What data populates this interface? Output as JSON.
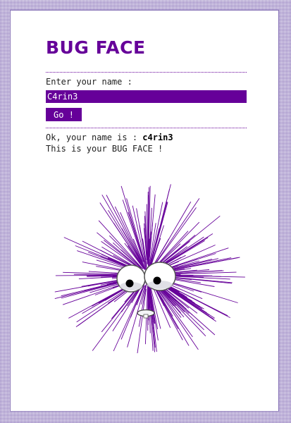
{
  "app": {
    "title": "BUG FACE"
  },
  "form": {
    "label": "Enter your name :",
    "name_value": "C4rin3",
    "go_label": "Go !"
  },
  "result": {
    "prefix": "Ok, your name is : ",
    "name": "c4rin3",
    "line2": "This is your BUG FACE !"
  },
  "bug": {
    "color": "#660099",
    "icon": "spiky-bug-face"
  },
  "colors": {
    "accent": "#660099",
    "background_pattern": "#7054aa"
  }
}
